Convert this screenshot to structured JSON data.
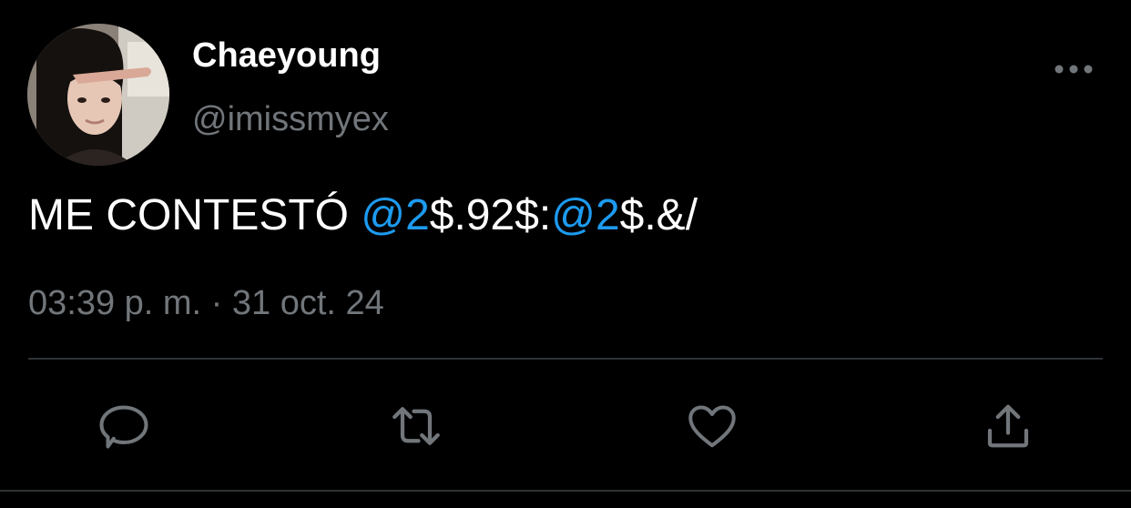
{
  "user": {
    "display_name": "Chaeyoung",
    "handle": "@imissmyex"
  },
  "tweet": {
    "text_parts": [
      {
        "text": "ME CONTESTÓ ",
        "type": "plain"
      },
      {
        "text": "@2",
        "type": "mention"
      },
      {
        "text": "$.92$:",
        "type": "plain"
      },
      {
        "text": "@2",
        "type": "mention"
      },
      {
        "text": "$.&/",
        "type": "plain"
      }
    ],
    "timestamp": "03:39 p. m. · 31 oct. 24"
  },
  "icons": {
    "more": "more-horizontal-icon",
    "reply": "reply-icon",
    "retweet": "retweet-icon",
    "like": "heart-icon",
    "share": "share-icon"
  },
  "colors": {
    "background": "#000000",
    "text": "#ffffff",
    "secondary": "#71767b",
    "mention": "#1d9bf0",
    "divider": "#2f3336"
  }
}
